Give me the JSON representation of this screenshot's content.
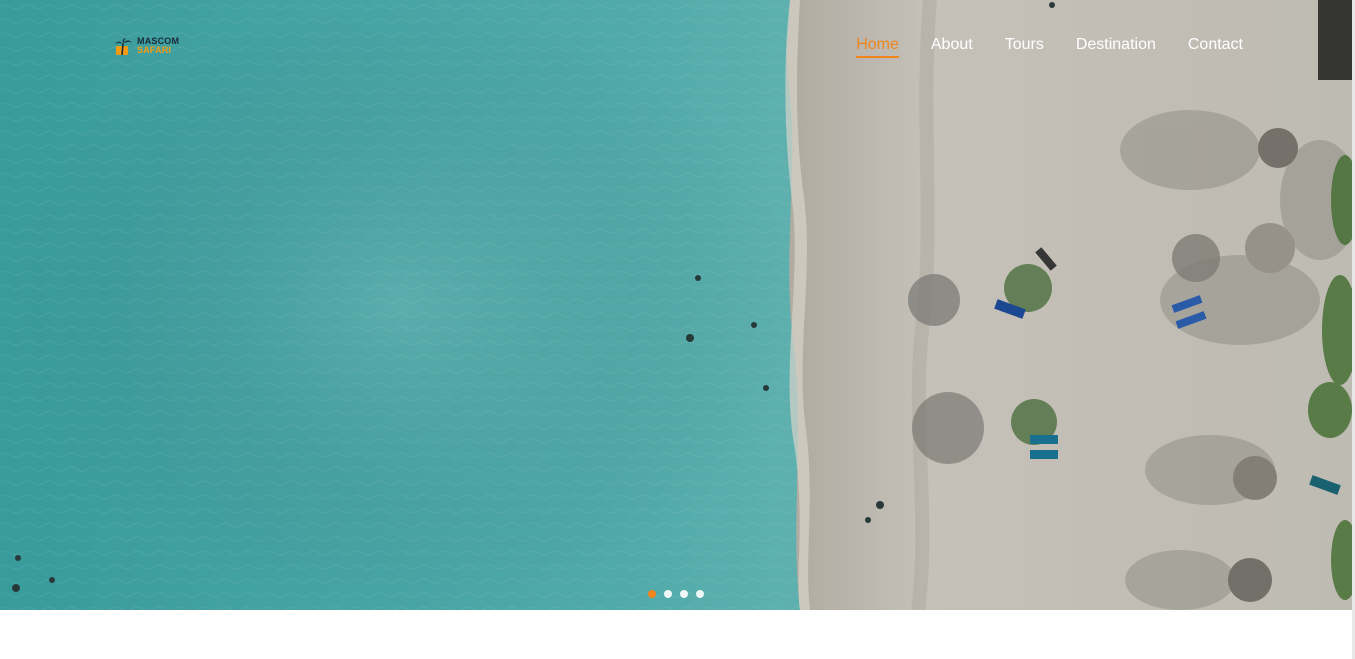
{
  "brand": {
    "line1": "MASCOM",
    "line2": "SAFARI",
    "icon": "palm-tree-icon",
    "colors": {
      "dark": "#1b2a3a",
      "accent": "#f39c12"
    }
  },
  "nav": {
    "items": [
      {
        "label": "Home",
        "active": true
      },
      {
        "label": "About",
        "active": false
      },
      {
        "label": "Tours",
        "active": false
      },
      {
        "label": "Destination",
        "active": false
      },
      {
        "label": "Contact",
        "active": false
      }
    ],
    "active_color": "#f0851a"
  },
  "hero": {
    "slides_count": 4,
    "active_slide": 1,
    "scene": "aerial beach photo"
  }
}
